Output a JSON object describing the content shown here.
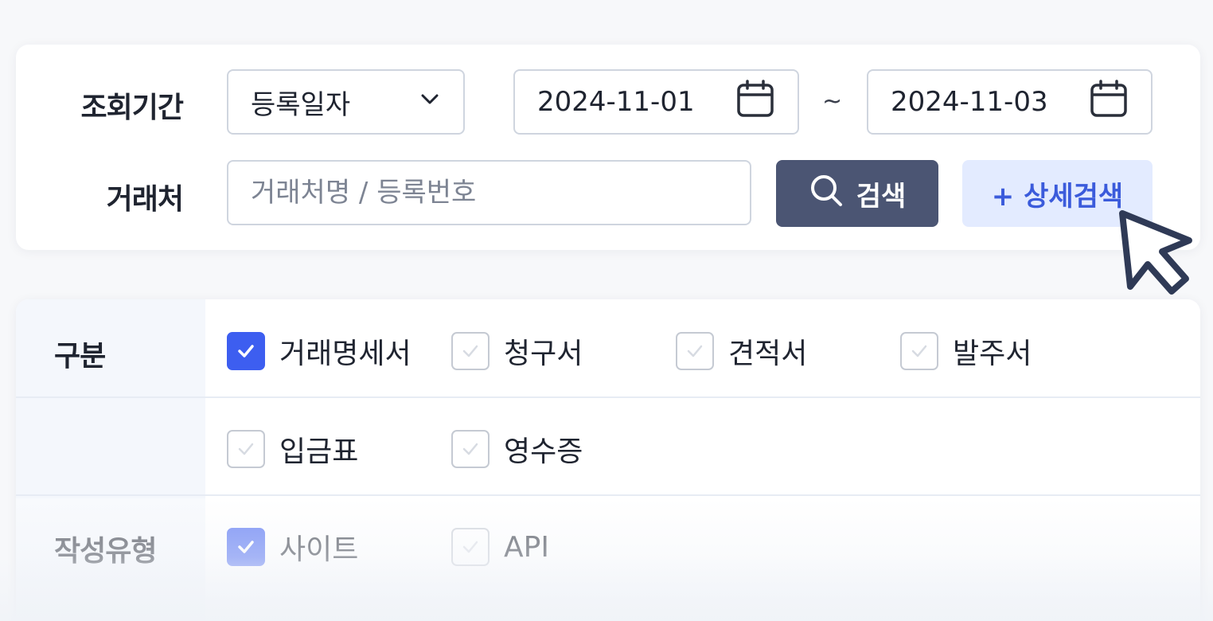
{
  "search": {
    "period_label": "조회기간",
    "date_basis": "등록일자",
    "start_date": "2024-11-01",
    "range_separator": "~",
    "end_date": "2024-11-03",
    "client_label": "거래처",
    "client_placeholder": "거래처명 / 등록번호",
    "search_button": "검색",
    "detail_search_button": "+ 상세검색"
  },
  "filters": {
    "type_label": "구분",
    "doc_types": [
      {
        "label": "거래명세서",
        "checked": true
      },
      {
        "label": "청구서",
        "checked": false
      },
      {
        "label": "견적서",
        "checked": false
      },
      {
        "label": "발주서",
        "checked": false
      },
      {
        "label": "입금표",
        "checked": false
      },
      {
        "label": "영수증",
        "checked": false
      }
    ],
    "creation_label": "작성유형",
    "creation_types": [
      {
        "label": "사이트",
        "checked": true
      },
      {
        "label": "API",
        "checked": false
      }
    ]
  },
  "colors": {
    "accent": "#3d5ef0",
    "search_button_bg": "#4b5573",
    "detail_button_bg": "#e3ebff",
    "detail_button_text": "#3b5bdb"
  }
}
